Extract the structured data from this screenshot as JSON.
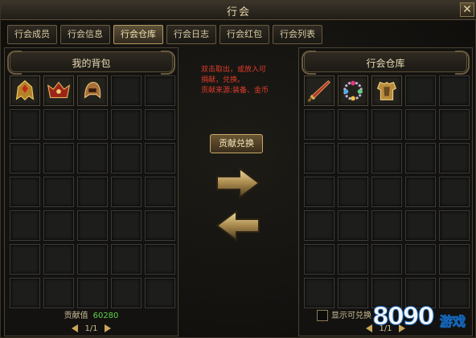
{
  "window": {
    "title": "行会",
    "close_label": "✕"
  },
  "tabs": [
    {
      "label": "行会成员",
      "active": false
    },
    {
      "label": "行会信息",
      "active": false
    },
    {
      "label": "行会仓库",
      "active": true
    },
    {
      "label": "行会日志",
      "active": false
    },
    {
      "label": "行会红包",
      "active": false
    },
    {
      "label": "行会列表",
      "active": false
    }
  ],
  "bag": {
    "title": "我的背包",
    "contribution_label": "贡献值",
    "contribution_value": "60280",
    "page": "1/1",
    "items": [
      "gold-helmet-icon",
      "red-helmet-icon",
      "gold-hood-icon"
    ]
  },
  "warehouse": {
    "title": "行会仓库",
    "filter_label": "显示可兑换",
    "page": "1/1",
    "items": [
      "red-sword-icon",
      "gem-necklace-icon",
      "gold-armor-icon"
    ]
  },
  "center": {
    "notice_lines": [
      "双击取出，或放入可",
      "捐献，兑换。",
      "贡献来源:装备、金币"
    ],
    "exchange_button": "贡献兑换"
  },
  "watermark": {
    "number": "8090",
    "text": "游戏"
  },
  "colors": {
    "accent_gold": "#c6a866",
    "contribution_green": "#5fd34a",
    "notice_red": "#e03c2a"
  }
}
